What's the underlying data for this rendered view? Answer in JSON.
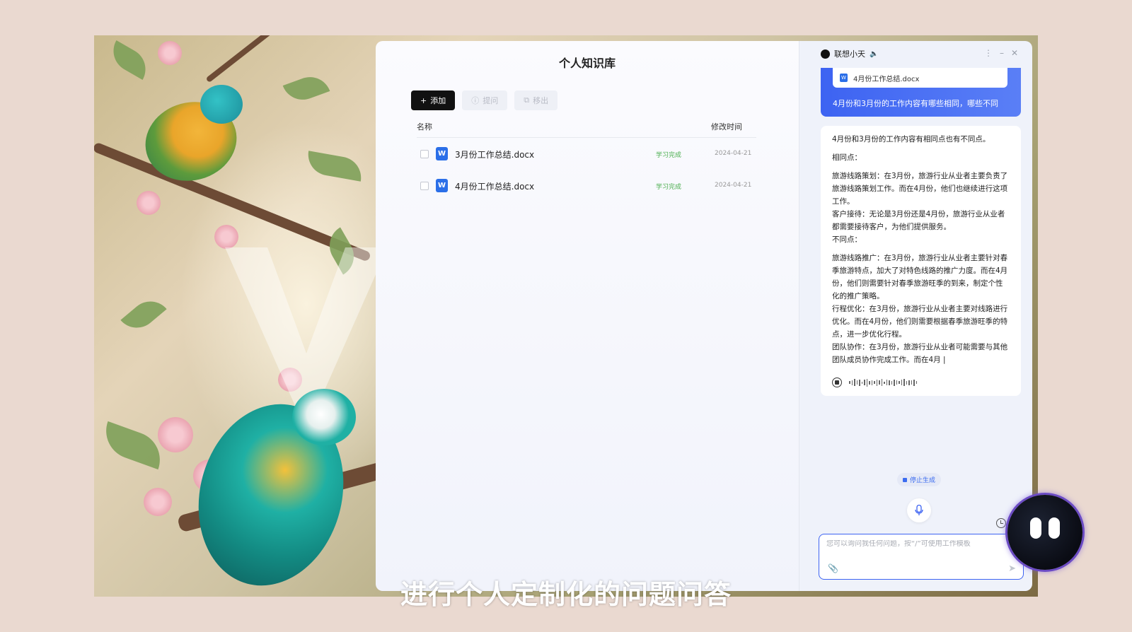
{
  "knowledge_base": {
    "title": "个人知识库",
    "toolbar": {
      "add_label": "添加",
      "ask_label": "提问",
      "remove_label": "移出"
    },
    "columns": {
      "name": "名称",
      "modified": "修改时间"
    },
    "files": [
      {
        "name": "3月份工作总结.docx",
        "status": "学习完成",
        "date": "2024-04-21"
      },
      {
        "name": "4月份工作总结.docx",
        "status": "学习完成",
        "date": "2024-04-21"
      }
    ]
  },
  "assistant": {
    "name": "联想小天",
    "user_message": {
      "attachment": "4月份工作总结.docx",
      "text": "4月份和3月份的工作内容有哪些相同，哪些不同"
    },
    "reply": {
      "intro": "4月份和3月份的工作内容有相同点也有不同点。",
      "same_heading": "相同点：",
      "same_1": "旅游线路策划：在3月份，旅游行业从业者主要负责了旅游线路策划工作。而在4月份，他们也继续进行这项工作。",
      "same_2": "客户接待：无论是3月份还是4月份，旅游行业从业者都需要接待客户，为他们提供服务。",
      "diff_heading": "不同点：",
      "diff_1": "旅游线路推广：在3月份，旅游行业从业者主要针对春季旅游特点，加大了对特色线路的推广力度。而在4月份，他们则需要针对春季旅游旺季的到来，制定个性化的推广策略。",
      "diff_2": "行程优化：在3月份，旅游行业从业者主要对线路进行优化。而在4月份，他们则需要根据春季旅游旺季的特点，进一步优化行程。",
      "diff_3": "团队协作：在3月份，旅游行业从业者可能需要与其他团队成员协作完成工作。而在4月 |"
    },
    "stop_label": "停止生成",
    "input_placeholder": "您可以询问我任何问题，按“/”可使用工作模板"
  },
  "subtitle": "进行个人定制化的问题问答",
  "colors": {
    "accent": "#3d63f2",
    "status_green": "#4caf50"
  }
}
